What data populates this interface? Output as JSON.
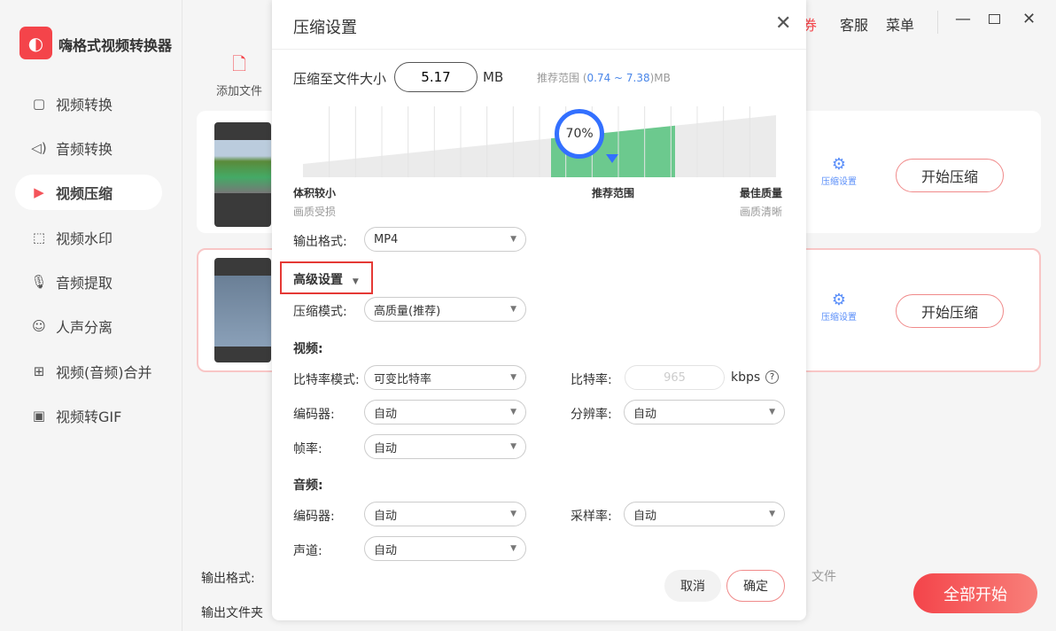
{
  "app": {
    "name": "嗨格式视频转换器",
    "header_coupon": "券",
    "header_service": "客服",
    "header_menu": "菜单"
  },
  "sidebar": {
    "items": [
      {
        "label": "视频转换",
        "icon": "video-convert-icon"
      },
      {
        "label": "音频转换",
        "icon": "audio-convert-icon"
      },
      {
        "label": "视频压缩",
        "icon": "video-compress-icon",
        "active": true
      },
      {
        "label": "视频水印",
        "icon": "watermark-icon"
      },
      {
        "label": "音频提取",
        "icon": "audio-extract-icon"
      },
      {
        "label": "人声分离",
        "icon": "vocal-separate-icon"
      },
      {
        "label": "视频(音频)合并",
        "icon": "merge-icon"
      },
      {
        "label": "视频转GIF",
        "icon": "gif-icon"
      }
    ]
  },
  "toolbar": {
    "add_file": "添加文件"
  },
  "files": [
    {
      "settings_label": "压缩设置",
      "start_label": "开始压缩"
    },
    {
      "settings_label": "压缩设置",
      "start_label": "开始压缩"
    }
  ],
  "bottom": {
    "output_format": "输出格式:",
    "output_folder": "输出文件夹",
    "open_file": "文件",
    "start_all": "全部开始"
  },
  "dialog": {
    "title": "压缩设置",
    "size_label": "压缩至文件大小",
    "size_value": "5.17",
    "size_unit": "MB",
    "range_prefix": "推荐范围 (",
    "range_value": "0.74 ~ 7.38",
    "range_suffix": ")MB",
    "slider_percent": 70,
    "slider_text": "70%",
    "left_label": "体积较小",
    "left_sub": "画质受损",
    "mid_label": "推荐范围",
    "right_label": "最佳质量",
    "right_sub": "画质清晰",
    "output_format_label": "输出格式:",
    "output_format": "MP4",
    "advanced": "高级设置",
    "mode_label": "压缩模式:",
    "mode": "高质量(推荐)",
    "video_section": "视频:",
    "bitrate_mode_label": "比特率模式:",
    "bitrate_mode": "可变比特率",
    "bitrate_label": "比特率:",
    "bitrate": "965",
    "bitrate_unit": "kbps",
    "v_encoder_label": "编码器:",
    "v_encoder": "自动",
    "resolution_label": "分辨率:",
    "resolution": "自动",
    "fps_label": "帧率:",
    "fps": "自动",
    "audio_section": "音频:",
    "a_encoder_label": "编码器:",
    "a_encoder": "自动",
    "samplerate_label": "采样率:",
    "samplerate": "自动",
    "channel_label": "声道:",
    "channel": "自动",
    "cancel": "取消",
    "ok": "确定"
  },
  "colors": {
    "accent": "#f4444a",
    "blue": "#3370ff",
    "green": "#6cc98e"
  }
}
